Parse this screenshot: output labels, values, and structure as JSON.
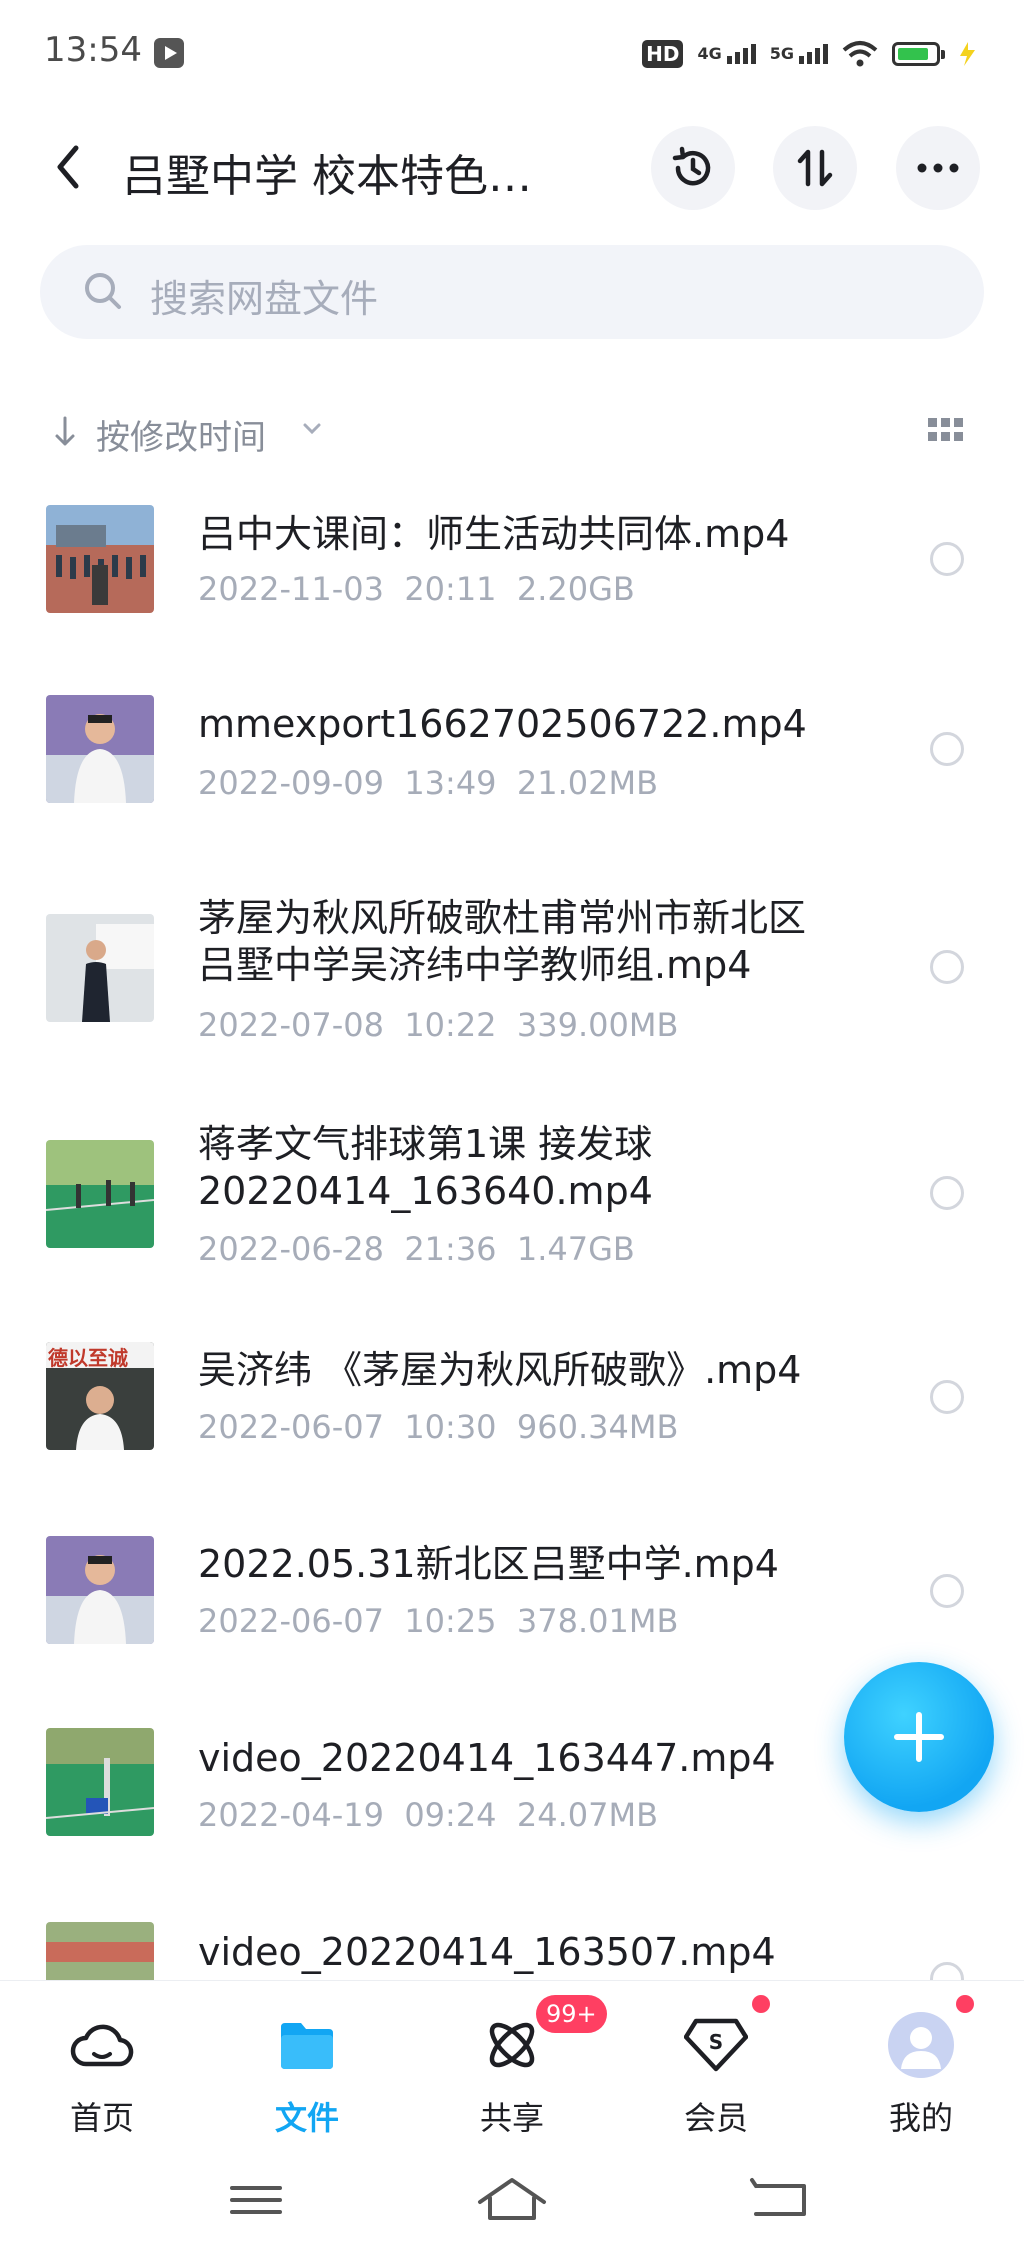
{
  "status": {
    "time": "13:54",
    "hd": "HD",
    "net1": "4G",
    "net2": "5G"
  },
  "header": {
    "title": "吕墅中学 校本特色…"
  },
  "search": {
    "placeholder": "搜索网盘文件"
  },
  "sort": {
    "label": "按修改时间"
  },
  "files": [
    {
      "name_lines": [
        "吕中大课间：师生活动共同体.mp4"
      ],
      "date": "2022-11-03",
      "time": "20:11",
      "size": "2.20GB",
      "thumb": "playground-icon"
    },
    {
      "name_lines": [
        "mmexport1662702506722.mp4"
      ],
      "date": "2022-09-09",
      "time": "13:49",
      "size": "21.02MB",
      "thumb": "speaker-icon"
    },
    {
      "name_lines": [
        "茅屋为秋风所破歌杜甫常州市新北区",
        "吕墅中学吴济纬中学教师组.mp4"
      ],
      "date": "2022-07-08",
      "time": "10:22",
      "size": "339.00MB",
      "thumb": "teacher-icon"
    },
    {
      "name_lines": [
        "蒋孝文气排球第1课 接发球",
        "20220414_163640.mp4"
      ],
      "date": "2022-06-28",
      "time": "21:36",
      "size": "1.47GB",
      "thumb": "court-icon"
    },
    {
      "name_lines": [
        "吴济纬 《茅屋为秋风所破歌》.mp4"
      ],
      "date": "2022-06-07",
      "time": "10:30",
      "size": "960.34MB",
      "thumb": "classroom-icon",
      "thumb_text": "德以至诚"
    },
    {
      "name_lines": [
        "2022.05.31新北区吕墅中学.mp4"
      ],
      "date": "2022-06-07",
      "time": "10:25",
      "size": "378.01MB",
      "thumb": "speaker-icon"
    },
    {
      "name_lines": [
        "video_20220414_163447.mp4"
      ],
      "date": "2022-04-19",
      "time": "09:24",
      "size": "24.07MB",
      "thumb": "court-icon"
    },
    {
      "name_lines": [
        "video_20220414_163507.mp4"
      ],
      "date": "",
      "time": "",
      "size": "",
      "thumb": "playground-icon"
    }
  ],
  "nav": {
    "home": "首页",
    "files": "文件",
    "share": "共享",
    "share_badge": "99+",
    "vip": "会员",
    "mine": "我的"
  },
  "colors": {
    "accent": "#12a6f3",
    "badge": "#ff3f62"
  }
}
